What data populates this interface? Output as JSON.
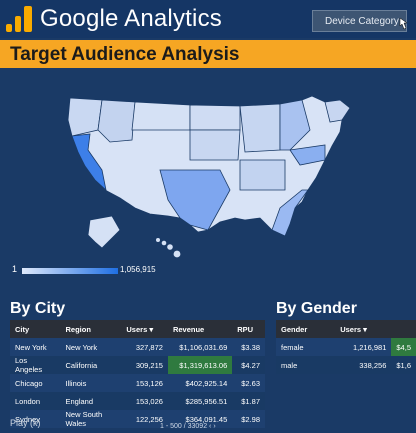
{
  "header": {
    "brand": "Google Analytics",
    "device_button": "Device Category"
  },
  "banner": {
    "title": "Target Audience Analysis"
  },
  "legend": {
    "min": "1",
    "max": "1,056,915"
  },
  "city": {
    "title": "By City",
    "headers": [
      "City",
      "Region",
      "Users ▾",
      "Revenue",
      "RPU"
    ],
    "rows": [
      [
        "New York",
        "New York",
        "327,872",
        "$1,106,031.69",
        "$3.38"
      ],
      [
        "Los Angeles",
        "California",
        "309,215",
        "$1,319,613.06",
        "$4.27"
      ],
      [
        "Chicago",
        "Illinois",
        "153,126",
        "$402,925.14",
        "$2.63"
      ],
      [
        "London",
        "England",
        "153,026",
        "$285,956.51",
        "$1.87"
      ],
      [
        "Sydney",
        "New South Wales",
        "122,256",
        "$364,091.45",
        "$2.98"
      ]
    ]
  },
  "gender": {
    "title": "By Gender",
    "headers": [
      "Gender",
      "Users ▾",
      ""
    ],
    "rows": [
      [
        "female",
        "1,216,981",
        "$4,5"
      ],
      [
        "male",
        "338,256",
        "$1,6"
      ]
    ]
  },
  "pager": "1 - 500 / 33092  ‹  ›",
  "play": "Play (k)"
}
